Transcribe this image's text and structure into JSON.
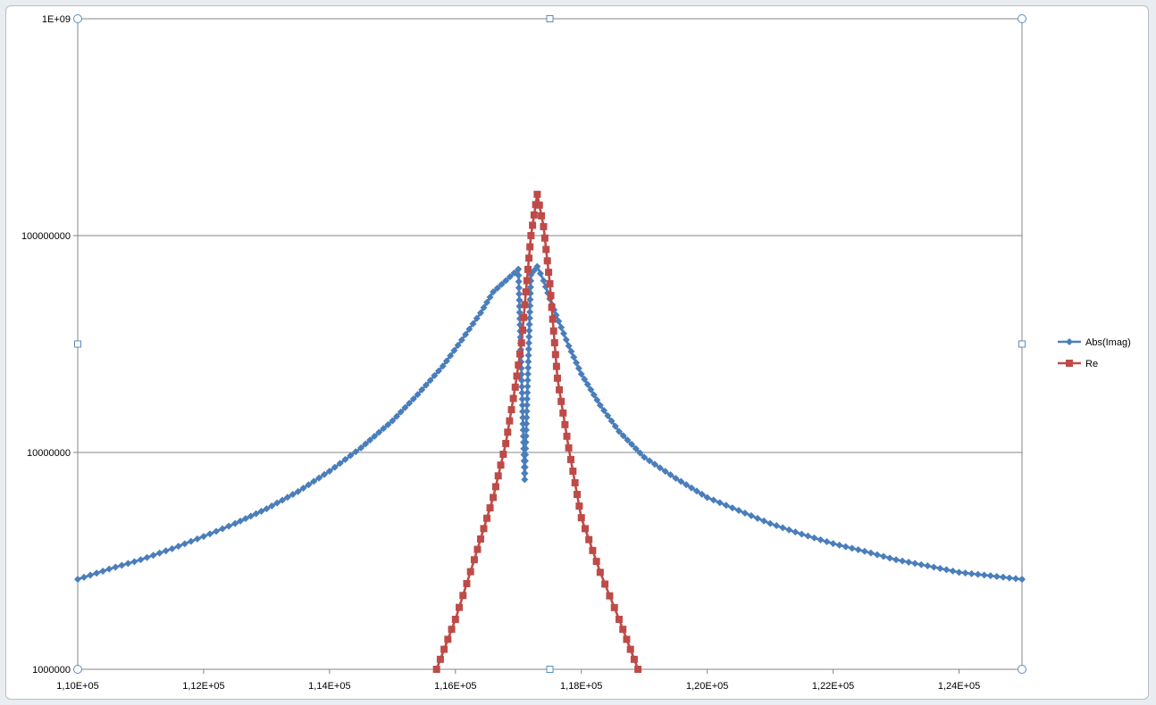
{
  "chart_data": {
    "type": "line",
    "title": "",
    "xlabel": "",
    "ylabel": "",
    "y_scale": "log",
    "xlim": [
      110000,
      125000
    ],
    "ylim": [
      1000000,
      1000000000
    ],
    "x_ticks": [
      110000,
      112000,
      114000,
      116000,
      118000,
      120000,
      122000,
      124000
    ],
    "x_tick_labels": [
      "1,10E+05",
      "1,12E+05",
      "1,14E+05",
      "1,16E+05",
      "1,18E+05",
      "1,20E+05",
      "1,22E+05",
      "1,24E+05"
    ],
    "y_ticks": [
      1000000,
      10000000,
      100000000,
      1000000000
    ],
    "y_tick_labels": [
      "1000000",
      "10000000",
      "100000000",
      "1E+09"
    ],
    "grid": "horizontal major",
    "legend": "right",
    "series": [
      {
        "name": "Abs(Imag)",
        "color": "#4a7ebb",
        "marker": "diamond",
        "x": [
          110000,
          110500,
          111000,
          111500,
          112000,
          112500,
          113000,
          113500,
          114000,
          114500,
          115000,
          115400,
          115800,
          116100,
          116400,
          116600,
          116800,
          117000,
          117100,
          117200,
          117300,
          117400,
          117500,
          117600,
          117800,
          118000,
          118300,
          118600,
          119000,
          119500,
          120000,
          120500,
          121000,
          121500,
          122000,
          122500,
          123000,
          123500,
          124000,
          124500,
          125000
        ],
        "y": [
          2600000,
          2900000,
          3200000,
          3600000,
          4100000,
          4700000,
          5500000,
          6600000,
          8200000,
          10500000,
          14000000,
          18500000,
          25000000,
          33000000,
          44000000,
          55000000,
          62000000,
          70000000,
          7500000,
          66000000,
          72000000,
          62000000,
          51000000,
          43000000,
          31000000,
          23000000,
          16500000,
          12500000,
          9500000,
          7600000,
          6200000,
          5400000,
          4700000,
          4200000,
          3800000,
          3500000,
          3200000,
          3000000,
          2800000,
          2700000,
          2600000
        ]
      },
      {
        "name": "Re",
        "color": "#be4b48",
        "marker": "square",
        "x": [
          115700,
          116000,
          116300,
          116600,
          116800,
          116950,
          117050,
          117120,
          117200,
          117300,
          117400,
          117500,
          117620,
          117800,
          118000,
          118300,
          118600,
          118900
        ],
        "y": [
          1000000,
          1700000,
          3200000,
          6200000,
          11000000,
          20000000,
          32000000,
          55000000,
          100000000,
          155000000,
          110000000,
          60000000,
          22000000,
          10500000,
          5000000,
          2800000,
          1700000,
          1000000
        ]
      }
    ]
  }
}
